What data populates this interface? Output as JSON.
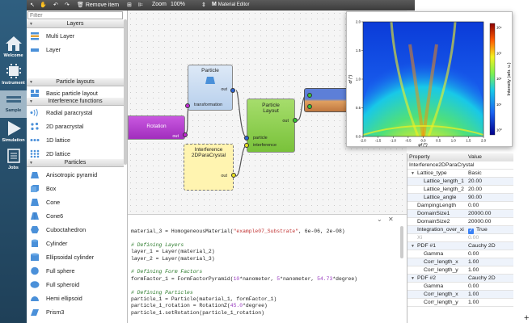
{
  "sidebar": {
    "items": [
      {
        "label": "Welcome",
        "icon": "home-icon"
      },
      {
        "label": "Instrument",
        "icon": "chip-icon"
      },
      {
        "label": "Sample",
        "icon": "sample-icon"
      },
      {
        "label": "Simulation",
        "icon": "play-icon"
      },
      {
        "label": "Jobs",
        "icon": "jobs-icon"
      }
    ]
  },
  "toolbar": {
    "remove_item": "Remove item",
    "zoom_label": "Zoom",
    "zoom_value": "100%",
    "material_editor": "Material Editor"
  },
  "palette": {
    "filter_placeholder": "Filter",
    "categories": {
      "layers": "Layers",
      "particle_layouts": "Particle layouts",
      "interference_functions": "Interference functions",
      "particles": "Particles"
    },
    "layers": [
      "Multi Layer",
      "Layer"
    ],
    "layouts": [
      "Basic particle layout"
    ],
    "interference": [
      "Radial paracrystal",
      "2D paracrystal",
      "1D lattice",
      "2D lattice"
    ],
    "particles": [
      "Anisotropic pyramid",
      "Box",
      "Cone",
      "Cone6",
      "Cuboctahedron",
      "Cylinder",
      "Ellipsoidal cylinder",
      "Full sphere",
      "Full spheroid",
      "Hemi ellipsoid",
      "Prism3"
    ]
  },
  "nodes": {
    "particle": {
      "title": "Particle",
      "port_out": "out",
      "port_transformation": "transformation"
    },
    "rotation": {
      "title": "Rotation",
      "port_out": "out"
    },
    "interference": {
      "title_line1": "Interference",
      "title_line2": "2DParaCrystal",
      "port_out": "out"
    },
    "layout": {
      "title_line1": "Particle",
      "title_line2": "Layout",
      "port_out": "out",
      "port_particle": "particle",
      "port_interference": "interference"
    }
  },
  "script": {
    "close": "✕",
    "collapse": "⌄",
    "lines": [
      {
        "parts": [
          {
            "t": "material_3 = HomogeneousMaterial(",
            "c": ""
          },
          {
            "t": "\"example07_Substrate\"",
            "c": "st"
          },
          {
            "t": ", 6e-06, 2e-08)",
            "c": ""
          }
        ]
      },
      {
        "parts": [
          {
            "t": "",
            "c": ""
          }
        ]
      },
      {
        "parts": [
          {
            "t": "# Defining Layers",
            "c": "cm"
          }
        ]
      },
      {
        "parts": [
          {
            "t": "layer_1 = Layer(material_2)",
            "c": ""
          }
        ]
      },
      {
        "parts": [
          {
            "t": "layer_2 = Layer(material_3)",
            "c": ""
          }
        ]
      },
      {
        "parts": [
          {
            "t": "",
            "c": ""
          }
        ]
      },
      {
        "parts": [
          {
            "t": "# Defining Form Factors",
            "c": "cm"
          }
        ]
      },
      {
        "parts": [
          {
            "t": "formFactor_1 = FormFactorPyramid(",
            "c": ""
          },
          {
            "t": "10",
            "c": "nu"
          },
          {
            "t": "*nanometer, ",
            "c": ""
          },
          {
            "t": "5",
            "c": "nu"
          },
          {
            "t": "*nanometer, ",
            "c": ""
          },
          {
            "t": "54.73",
            "c": "nu"
          },
          {
            "t": "*degree)",
            "c": ""
          }
        ]
      },
      {
        "parts": [
          {
            "t": "",
            "c": ""
          }
        ]
      },
      {
        "parts": [
          {
            "t": "# Defining Particles",
            "c": "cm"
          }
        ]
      },
      {
        "parts": [
          {
            "t": "particle_1 = Particle(material_1, formFactor_1)",
            "c": ""
          }
        ]
      },
      {
        "parts": [
          {
            "t": "particle_1_rotation = RotationZ(",
            "c": ""
          },
          {
            "t": "45.0",
            "c": "nu"
          },
          {
            "t": "*degree)",
            "c": ""
          }
        ]
      },
      {
        "parts": [
          {
            "t": "particle_1.setRotation(particle_1_rotation)",
            "c": ""
          }
        ]
      }
    ]
  },
  "properties": {
    "header_property": "Property",
    "header_value": "Value",
    "title": "Interference2DParaCrystal",
    "rows": [
      {
        "k": "Lattice_type",
        "v": "Basic",
        "indent": 1,
        "tri": true
      },
      {
        "k": "Lattice_length_1",
        "v": "20.00",
        "indent": 2
      },
      {
        "k": "Lattice_length_2",
        "v": "20.00",
        "indent": 2
      },
      {
        "k": "Lattice_angle",
        "v": "90.00",
        "indent": 2
      },
      {
        "k": "DampingLength",
        "v": "0.00",
        "indent": 1
      },
      {
        "k": "DomainSize1",
        "v": "20000.00",
        "indent": 1
      },
      {
        "k": "DomainSize2",
        "v": "20000.00",
        "indent": 1
      },
      {
        "k": "Integration_over_xi",
        "v": "True",
        "indent": 1,
        "check": true
      },
      {
        "k": "Xi",
        "v": "0.00",
        "indent": 1,
        "dim": true
      },
      {
        "k": "PDF #1",
        "v": "Cauchy 2D",
        "indent": 1,
        "tri": true
      },
      {
        "k": "Gamma",
        "v": "0.00",
        "indent": 2
      },
      {
        "k": "Corr_length_x",
        "v": "1.00",
        "indent": 2
      },
      {
        "k": "Corr_length_y",
        "v": "1.00",
        "indent": 2
      },
      {
        "k": "PDF #2",
        "v": "Cauchy 2D",
        "indent": 1,
        "tri": true
      },
      {
        "k": "Gamma",
        "v": "0.00",
        "indent": 2
      },
      {
        "k": "Corr_length_x",
        "v": "1.00",
        "indent": 2
      },
      {
        "k": "Corr_length_y",
        "v": "1.00",
        "indent": 2
      }
    ]
  },
  "heatmap": {
    "x_ticks": [
      "-2.0",
      "-1.5",
      "-1.0",
      "-0.5",
      "0.0",
      "0.5",
      "1.0",
      "1.5",
      "2.0"
    ],
    "y_ticks": [
      "0.0",
      "0.5",
      "1.0",
      "1.5",
      "2.0"
    ],
    "xlabel": "φf (°)",
    "ylabel": "αf (°)",
    "colorbar_label": "Intensity (arb. u.)",
    "colorbar_ticks": [
      "10⁰",
      "10¹",
      "10²",
      "10³",
      "10⁴"
    ]
  },
  "colors": {
    "sidebar_top": "#2f5f80",
    "node_particle": "#c5d9f1",
    "node_layout": "#8fd14f",
    "node_rotation": "#b93fd6",
    "node_interference": "#fff4b0"
  },
  "corner_symbol": "+"
}
